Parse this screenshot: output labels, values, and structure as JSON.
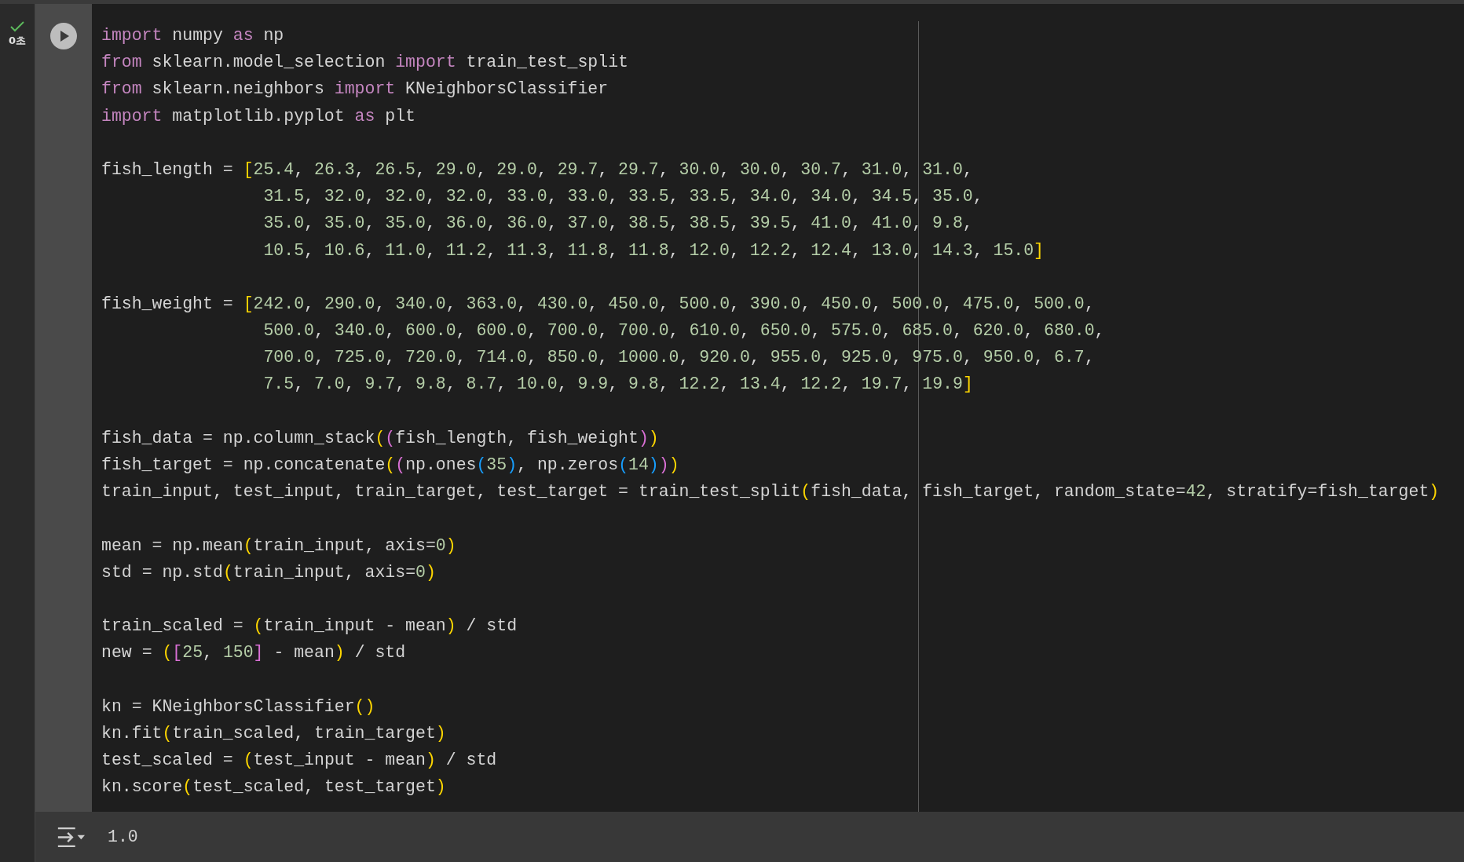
{
  "cell": {
    "status": {
      "done": true,
      "time": "0초"
    },
    "code_blocks": [
      [
        "import numpy as np",
        "from sklearn.model_selection import train_test_split",
        "from sklearn.neighbors import KNeighborsClassifier",
        "import matplotlib.pyplot as plt"
      ],
      [
        "fish_length = [25.4, 26.3, 26.5, 29.0, 29.0, 29.7, 29.7, 30.0, 30.0, 30.7, 31.0, 31.0,",
        "                31.5, 32.0, 32.0, 32.0, 33.0, 33.0, 33.5, 33.5, 34.0, 34.0, 34.5, 35.0,",
        "                35.0, 35.0, 35.0, 36.0, 36.0, 37.0, 38.5, 38.5, 39.5, 41.0, 41.0, 9.8,",
        "                10.5, 10.6, 11.0, 11.2, 11.3, 11.8, 11.8, 12.0, 12.2, 12.4, 13.0, 14.3, 15.0]"
      ],
      [
        "fish_weight = [242.0, 290.0, 340.0, 363.0, 430.0, 450.0, 500.0, 390.0, 450.0, 500.0, 475.0, 500.0,",
        "                500.0, 340.0, 600.0, 600.0, 700.0, 700.0, 610.0, 650.0, 575.0, 685.0, 620.0, 680.0,",
        "                700.0, 725.0, 720.0, 714.0, 850.0, 1000.0, 920.0, 955.0, 925.0, 975.0, 950.0, 6.7,",
        "                7.5, 7.0, 9.7, 9.8, 8.7, 10.0, 9.9, 9.8, 12.2, 13.4, 12.2, 19.7, 19.9]"
      ],
      [
        "fish_data = np.column_stack((fish_length, fish_weight))",
        "fish_target = np.concatenate((np.ones(35), np.zeros(14)))",
        "train_input, test_input, train_target, test_target = train_test_split(fish_data, fish_target, random_state=42, stratify=fish_target)"
      ],
      [
        "mean = np.mean(train_input, axis=0)",
        "std = np.std(train_input, axis=0)"
      ],
      [
        "train_scaled = (train_input - mean) / std",
        "new = ([25, 150] - mean) / std"
      ],
      [
        "kn = KNeighborsClassifier()",
        "kn.fit(train_scaled, train_target)",
        "test_scaled = (test_input - mean) / std",
        "kn.score(test_scaled, test_target)"
      ]
    ],
    "output": "1.0"
  }
}
